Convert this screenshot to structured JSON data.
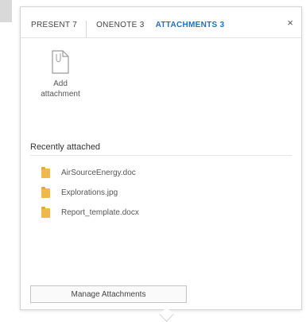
{
  "tabs": [
    {
      "label": "PRESENT 7",
      "active": false
    },
    {
      "label": "ONENOTE 3",
      "active": false
    },
    {
      "label": "ATTACHMENTS 3",
      "active": true
    }
  ],
  "close_icon": "×",
  "add_attachment": {
    "label_line1": "Add",
    "label_line2": "attachment",
    "icon": "file-icon"
  },
  "recent": {
    "title": "Recently attached",
    "files": [
      {
        "name": "AirSourceEnergy.doc",
        "icon": "folder-icon"
      },
      {
        "name": "Explorations.jpg",
        "icon": "folder-icon"
      },
      {
        "name": "Report_template.docx",
        "icon": "folder-icon"
      }
    ]
  },
  "manage_button": "Manage Attachments",
  "colors": {
    "accent": "#1f6fc4",
    "folder": "#f0b94b"
  }
}
